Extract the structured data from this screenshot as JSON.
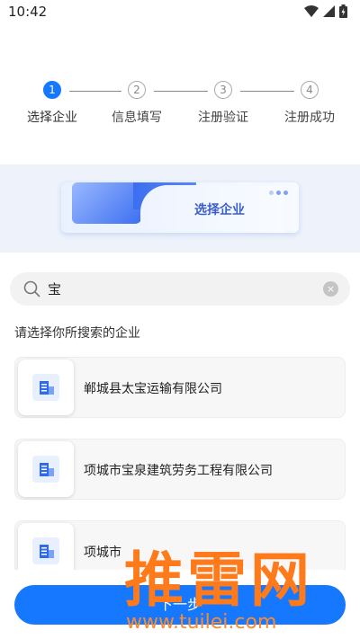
{
  "status_bar": {
    "time": "10:42"
  },
  "stepper": {
    "steps": [
      {
        "number": "1",
        "label": "选择企业"
      },
      {
        "number": "2",
        "label": "信息填写"
      },
      {
        "number": "3",
        "label": "注册验证"
      },
      {
        "number": "4",
        "label": "注册成功"
      }
    ],
    "active_step": 1
  },
  "banner": {
    "title": "选择企业"
  },
  "search": {
    "value": "宝",
    "clear_symbol": "×"
  },
  "hint": "请选择你所搜索的企业",
  "companies": [
    {
      "name": "郸城县太宝运输有限公司"
    },
    {
      "name": "项城市宝泉建筑劳务工程有限公司"
    },
    {
      "name": "项城市"
    }
  ],
  "next_button": {
    "label": "下一步"
  },
  "watermark": {
    "text": "推雷网",
    "url": "www.tuilei.com"
  },
  "colors": {
    "accent": "#1677ff",
    "watermark": "#ff7a1a"
  }
}
